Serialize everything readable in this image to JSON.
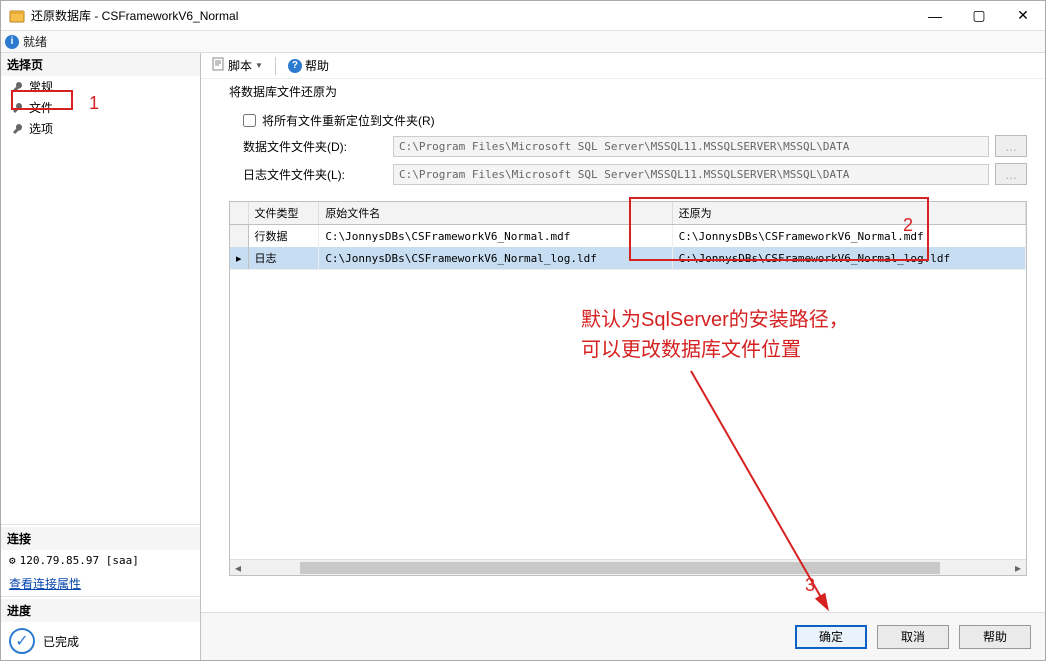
{
  "window": {
    "title": "还原数据库 - CSFrameworkV6_Normal",
    "min": "—",
    "max": "▢",
    "close": "✕"
  },
  "statusbar": {
    "text": "就绪"
  },
  "sidebar": {
    "select_page": "选择页",
    "items": [
      {
        "label": "常规"
      },
      {
        "label": "文件"
      },
      {
        "label": "选项"
      }
    ],
    "connection_hdr": "连接",
    "connection_value": "120.79.85.97 [saa]",
    "view_conn_props": "查看连接属性",
    "progress_hdr": "进度",
    "progress_text": "已完成"
  },
  "toolbar": {
    "script_label": "脚本",
    "dropdown_glyph": "▼",
    "help_label": "帮助"
  },
  "restore": {
    "legend": "将数据库文件还原为",
    "relocate_label": "将所有文件重新定位到文件夹(R)",
    "data_folder_label": "数据文件文件夹(D):",
    "log_folder_label": "日志文件文件夹(L):",
    "data_folder_value": "C:\\Program Files\\Microsoft SQL Server\\MSSQL11.MSSQLSERVER\\MSSQL\\DATA",
    "log_folder_value": "C:\\Program Files\\Microsoft SQL Server\\MSSQL11.MSSQLSERVER\\MSSQL\\DATA",
    "browse_label": "..."
  },
  "grid": {
    "headers": {
      "type": "文件类型",
      "orig": "原始文件名",
      "restore_as": "还原为"
    },
    "rows": [
      {
        "type": "行数据",
        "orig": "C:\\JonnysDBs\\CSFrameworkV6_Normal.mdf",
        "restore_as": "C:\\JonnysDBs\\CSFrameworkV6_Normal.mdf"
      },
      {
        "type": "日志",
        "orig": "C:\\JonnysDBs\\CSFrameworkV6_Normal_log.ldf",
        "restore_as": "C:\\JonnysDBs\\CSFrameworkV6_Normal_log.ldf"
      }
    ]
  },
  "footer": {
    "ok": "确定",
    "cancel": "取消",
    "help": "帮助"
  },
  "annotations": {
    "l1": "1",
    "l2": "2",
    "l3": "3",
    "note_line1": "默认为SqlServer的安装路径，",
    "note_line2": "可以更改数据库文件位置"
  }
}
